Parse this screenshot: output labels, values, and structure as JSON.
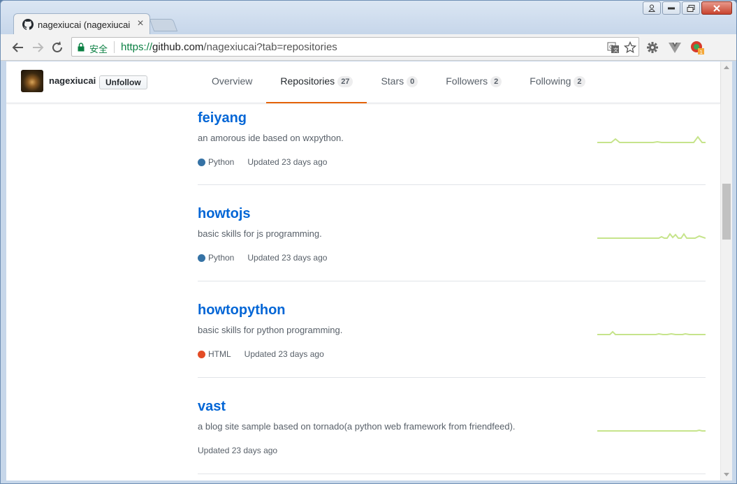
{
  "browser": {
    "tab_title": "nagexiucai (nagexiucai",
    "url_scheme": "https://",
    "url_host": "github.com",
    "url_path": "/nagexiucai?tab=repositories",
    "secure_label": "安全"
  },
  "profile": {
    "username": "nagexiucai",
    "unfollow_label": "Unfollow",
    "tabs": [
      {
        "label": "Overview",
        "count": ""
      },
      {
        "label": "Repositories",
        "count": "27"
      },
      {
        "label": "Stars",
        "count": "0"
      },
      {
        "label": "Followers",
        "count": "2"
      },
      {
        "label": "Following",
        "count": "2"
      }
    ],
    "selected_tab": "Repositories"
  },
  "repos": [
    {
      "name": "feiyang",
      "description": "an amorous ide based on wxpython.",
      "language": "Python",
      "language_color": "#3572A5",
      "updated": "Updated 23 days ago"
    },
    {
      "name": "howtojs",
      "description": "basic skills for js programming.",
      "language": "Python",
      "language_color": "#3572A5",
      "updated": "Updated 23 days ago"
    },
    {
      "name": "howtopython",
      "description": "basic skills for python programming.",
      "language": "HTML",
      "language_color": "#e34c26",
      "updated": "Updated 23 days ago"
    },
    {
      "name": "vast",
      "description": "a blog site sample based on tornado(a python web framework from friendfeed).",
      "language": "",
      "language_color": "",
      "updated": "Updated 23 days ago"
    }
  ],
  "colors": {
    "link": "#0366d6",
    "sparkline": "#c6e48b",
    "tab_underline": "#e36209"
  }
}
